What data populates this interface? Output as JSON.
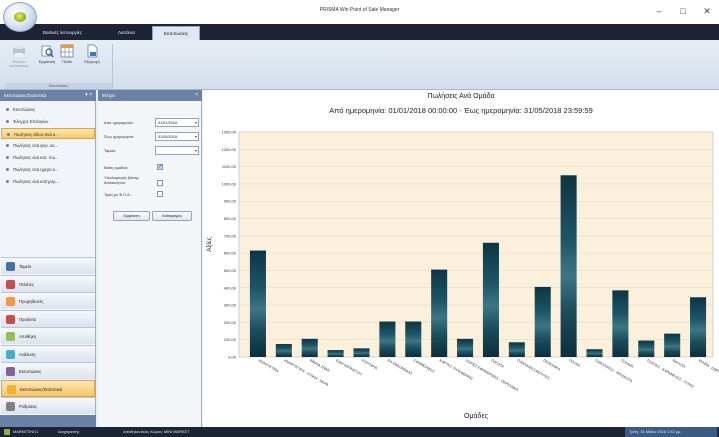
{
  "window": {
    "title": "PRISMA Win Point of Sale Manager",
    "minimize": "–",
    "maximize": "□",
    "close": "✕"
  },
  "menu": {
    "tabs": [
      "Βασικές λειτουργίες",
      "Λιστάνια",
      "Εκτυπώσεις"
    ],
    "active_tab": "Εκτυπώσεις"
  },
  "ribbon": {
    "buttons": [
      {
        "label": "Έντυπο εκτύπωσης",
        "enabled": false,
        "icon": "print-icon"
      },
      {
        "label": "Εμφάνιση",
        "enabled": true,
        "icon": "view-icon"
      },
      {
        "label": "Πεδία",
        "enabled": true,
        "icon": "grid-icon"
      },
      {
        "label": "Εξαγωγή",
        "enabled": true,
        "icon": "export-icon"
      }
    ],
    "group_label": "Εκτυπώσεις"
  },
  "nav": {
    "header": "Εκτυπώσεις/Στατιστικά",
    "pin_icon": "▾ ×",
    "items": [
      "Εκτυπώσεις",
      "Έλεγχος Επιλογών",
      "Πωλήσεις είδων ανά κ...",
      "Πωλήσεις ανά φορ. κα...",
      "Πωλήσεις ανά κατ. πω...",
      "Πωλήσεις ανά ημέρα κ...",
      "Πωλήσεις ανά κατηγορ..."
    ],
    "active_item": 2,
    "modules": [
      {
        "label": "Ταμείο",
        "color": "#4a6fa5"
      },
      {
        "label": "Πελάτες",
        "color": "#c0504d"
      },
      {
        "label": "Προμηθευτές",
        "color": "#f79646"
      },
      {
        "label": "Προϊόντα",
        "color": "#c0504d"
      },
      {
        "label": "Αποθήκη",
        "color": "#9bbb59"
      },
      {
        "label": "Ανάλυση",
        "color": "#4bacc6"
      },
      {
        "label": "Εκτυπώσεις",
        "color": "#8064a2"
      },
      {
        "label": "Εκτυπώσεις/Στατιστικά",
        "color": "#f2b035"
      },
      {
        "label": "Ρυθμίσεις",
        "color": "#7f7f7f"
      }
    ],
    "active_module": 7
  },
  "filter": {
    "header": "Φίλτρα",
    "close_icon": "×",
    "date_from_label": "Από ημερομηνία:",
    "date_from": "01/01/2018",
    "date_to_label": "Έως ημερομηνία:",
    "date_to": "31/05/2018",
    "register_label": "Ταμείο:",
    "register_value": "",
    "group_label": "Βάση ομαδας:",
    "group_checked": true,
    "auto_label": "Υπολογισμός βάσης Αυτοκινήτου:",
    "auto_checked": false,
    "vat_label": "Τιμές με Φ.Π.Α.:",
    "vat_checked": false,
    "btn_show": "Εμφάνιση",
    "btn_clear": "Καθαρισμός"
  },
  "report": {
    "title": "Πωλήσεις Ανά Ομάδα",
    "subtitle": "Από ημερομηνία: 01/01/2018 00:00:00 - Έως ημερομηνία: 31/05/2018 23:59:59"
  },
  "chart_data": {
    "type": "bar",
    "title": "Πωλήσεις Ανά Ομάδα",
    "xlabel": "Ομάδες",
    "ylabel": "Αξίες",
    "ylim": [
      0,
      1300
    ],
    "yticks": [
      "0,00",
      "100,00",
      "200,00",
      "300,00",
      "400,00",
      "500,00",
      "600,00",
      "700,00",
      "800,00",
      "900,00",
      "1000,00",
      "1100,00",
      "1200,00",
      "1300,00"
    ],
    "categories": [
      "ΑΝΑΨΥΚΤΙΚΑ",
      "ΑΝΑΨΥΚΤΙΚΑ - ΧΥΜΟΙ - ΝΕΡΑ",
      "ΒΙΒΛΙΑ ΣΝΑΚ",
      "ΕΙΔΗ ΚΑΠΝΙΣΤΟΥ",
      "ΕΙΣΙΤΗΡΙΑ",
      "ΕΚ ΕΒΔΟΜΑΔΑΣ",
      "ΕΦΗΜΕΡΙΔΕΣ",
      "ΚΑΡΤΕΣ ΤΗΛΕΦΩΝΙΑΣ",
      "ΛΟΙΠΕΣ ΕΦΗΜΕΡΙΔΕΣ - ΠΕΡΙΟΔΙΚΑ",
      "ΠΑΓΩΤΑ",
      "ΠΑΙΧΝΙΔΙΑ ΣΑΚΟΥΛΕΣ",
      "ΠΕΡΙΟΔΙΚΑ",
      "ΠΟΥΡΑ",
      "ΣΟΚΟΛΑΤΕΣ - ΜΠΙΣΚΟΤΑ",
      "ΤΣΙΓΑΡΑ",
      "ΤΣΙΧΛΕΣ - ΚΑΡΑΜΕΛΕΣ - ΓΛΥΚΑ",
      "ΦΑΓΗΤΑ",
      "ΨΙΛΙΚΑ - ΔΩΡΑ"
    ],
    "values": [
      615,
      75,
      105,
      40,
      50,
      205,
      205,
      505,
      105,
      660,
      85,
      405,
      1050,
      45,
      385,
      95,
      135,
      345
    ],
    "bar_color": "#13404f",
    "plot_bg": "#faf0dc"
  },
  "status": {
    "company": "MARKETING1",
    "user": "Διαχειριστής",
    "register": "Αποθηκευτικός Χώρος: MINI MARKET",
    "datetime": "Τρίτη, 31 Μαΐου 2018  1:52 μμ"
  }
}
